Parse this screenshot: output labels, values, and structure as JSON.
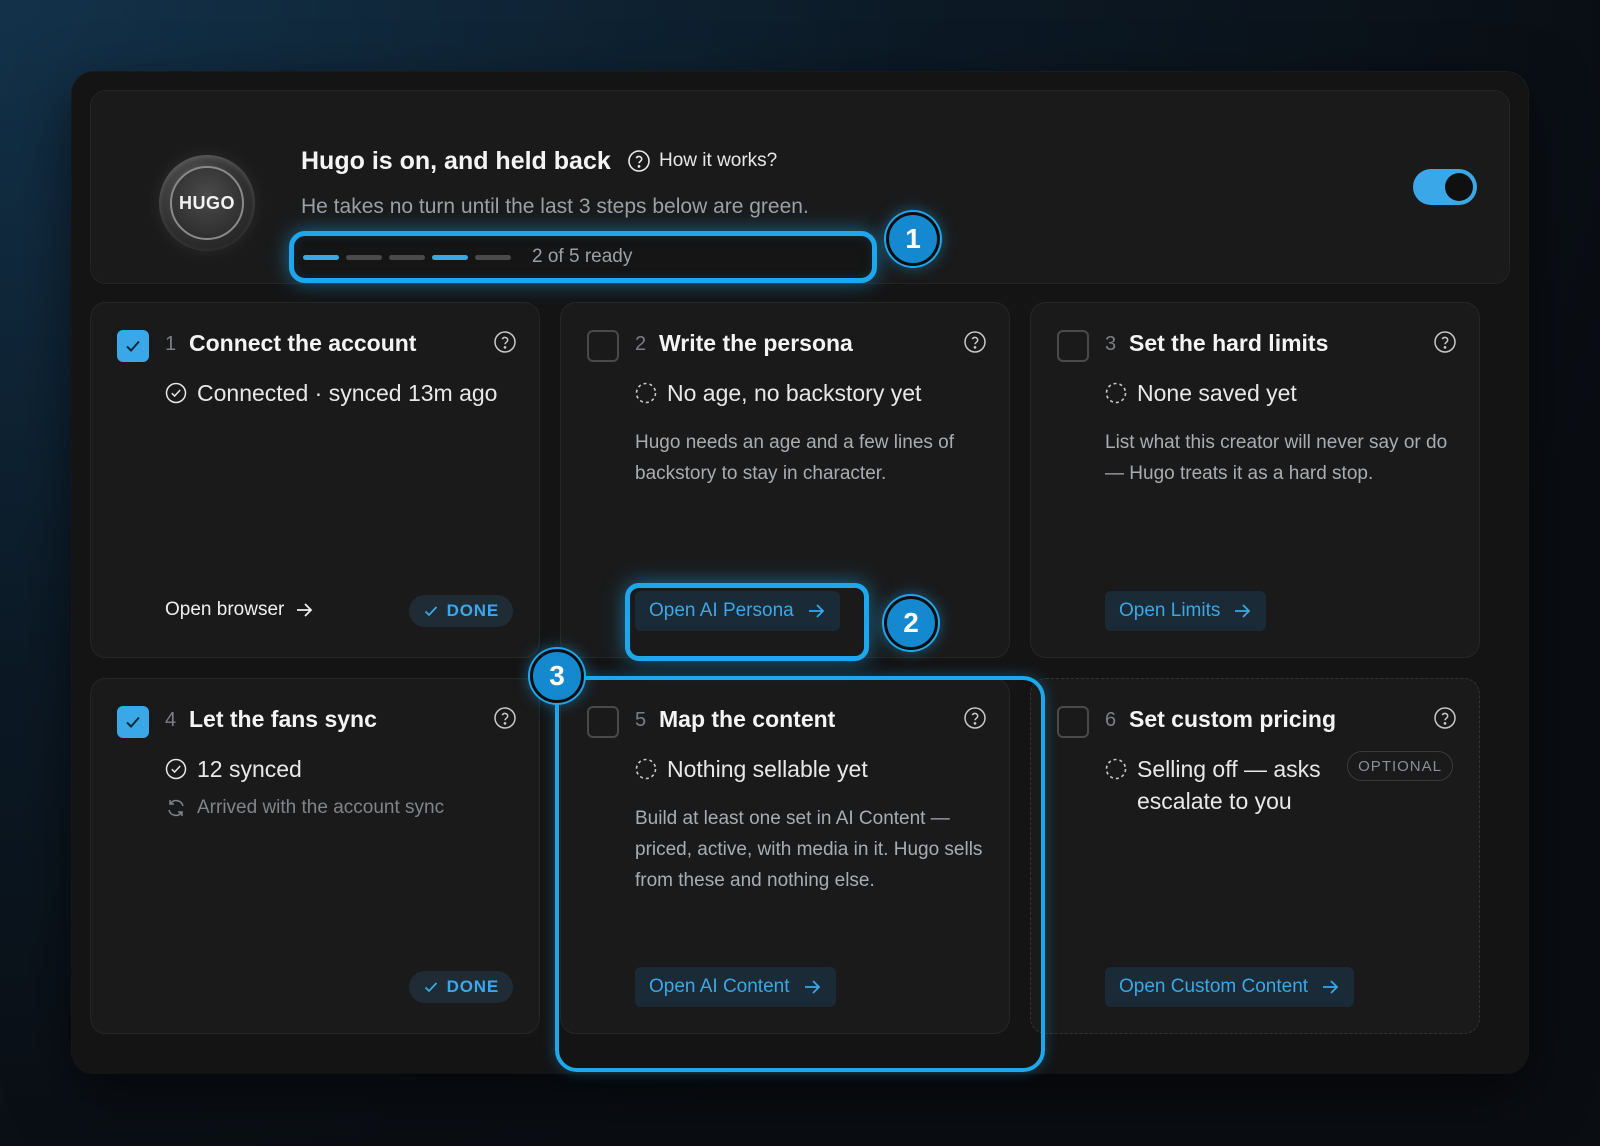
{
  "header": {
    "logo_text": "HUGO",
    "title": "Hugo is on, and held back",
    "how_it_works": "How it works?",
    "subtitle": "He takes no turn until the last 3 steps below are green.",
    "progress": {
      "ready_count": 2,
      "total": 5,
      "segments": [
        true,
        false,
        false,
        true,
        false
      ],
      "label": "2 of 5 ready"
    },
    "toggle_on": true
  },
  "callouts": [
    "1",
    "2",
    "3"
  ],
  "cards": [
    {
      "num": "1",
      "title": "Connect the account",
      "checked": true,
      "status": "Connected · synced 13m ago",
      "action": "Open browser",
      "done": "DONE"
    },
    {
      "num": "2",
      "title": "Write the persona",
      "checked": false,
      "status": "No age, no backstory yet",
      "desc": "Hugo needs an age and a few lines of backstory to stay in character.",
      "action": "Open AI Persona"
    },
    {
      "num": "3",
      "title": "Set the hard limits",
      "checked": false,
      "status": "None saved yet",
      "desc": "List what this creator will never say or do — Hugo treats it as a hard stop.",
      "action": "Open Limits"
    },
    {
      "num": "4",
      "title": "Let the fans sync",
      "checked": true,
      "status": "12 synced",
      "sub": "Arrived with the account sync",
      "done": "DONE"
    },
    {
      "num": "5",
      "title": "Map the content",
      "checked": false,
      "status": "Nothing sellable yet",
      "desc": "Build at least one set in AI Content — priced, active, with media in it. Hugo sells from these and nothing else.",
      "action": "Open AI Content"
    },
    {
      "num": "6",
      "title": "Set custom pricing",
      "checked": false,
      "status": "Selling off — asks escalate to you",
      "badge": "OPTIONAL",
      "action": "Open Custom Content"
    }
  ],
  "colors": {
    "accent": "#3aa8e8",
    "highlight": "#1ea7ec",
    "background": "#141414"
  }
}
